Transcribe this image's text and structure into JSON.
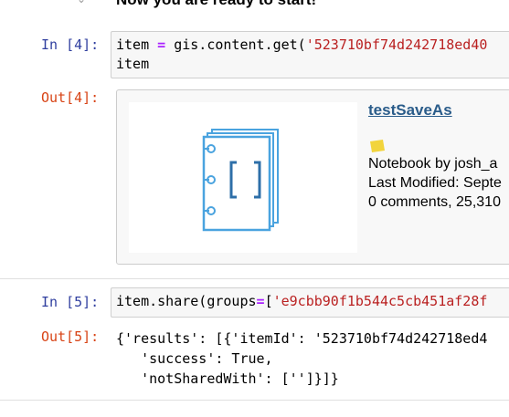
{
  "markdown": {
    "heading": "Now you are ready to start!"
  },
  "cell4": {
    "in_prompt": "In [4]:",
    "out_prompt": "Out[4]:",
    "code": {
      "l1_a": "item ",
      "l1_op": "=",
      "l1_b": " gis.content.get(",
      "l1_str": "'523710bf74d242718ed40",
      "l2": "item"
    },
    "item": {
      "title": "testSaveAs",
      "owner_line": "Notebook by josh_a",
      "modified_line": "Last Modified: Septe",
      "stats_line": "0 comments, 25,310",
      "type_icon": "notebook-type-icon",
      "thumbnail_icon": "notebook-thumbnail-icon"
    }
  },
  "cell5": {
    "in_prompt": "In [5]:",
    "out_prompt": "Out[5]:",
    "code": {
      "a": "item.share(groups",
      "op": "=",
      "b": "[",
      "str": "'e9cbb90f1b544c5cb451af28f"
    },
    "output_lines": [
      "{'results': [{'itemId': '523710bf74d242718ed4",
      "   'success': True,",
      "   'notSharedWith': ['']}]}"
    ]
  },
  "colors": {
    "in_prompt": "#303f9f",
    "out_prompt": "#d84315",
    "keyword_op": "#aa22ff",
    "string": "#ba2121",
    "link": "#2a5c8a",
    "notebook_blue": "#4aa3df",
    "type_icon_yellow": "#f2d43c"
  }
}
